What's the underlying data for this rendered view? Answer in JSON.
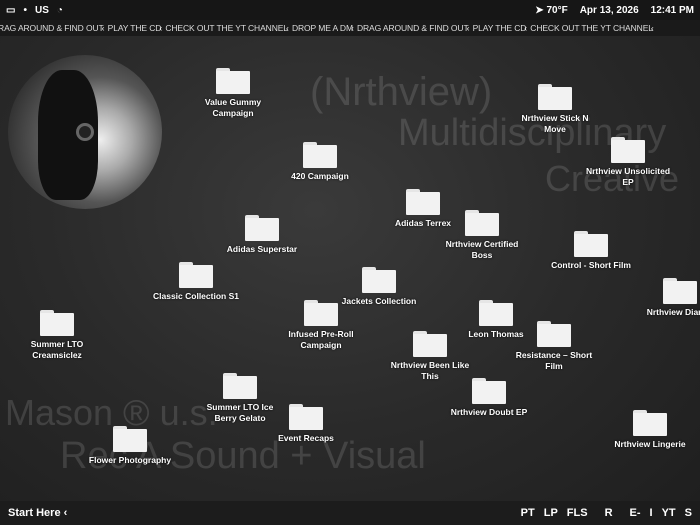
{
  "menubar": {
    "language": "US",
    "weather": "70°F",
    "date": "Apr 13, 2026",
    "time": "12:41 PM"
  },
  "ticker": [
    "DRAG AROUND & FIND OUT",
    "PLAY THE CD",
    "CHECK OUT THE YT CHANNEL",
    "DROP ME A DM",
    "DRAG AROUND & FIND OUT",
    "PLAY THE CD",
    "CHECK OUT THE YT CHANNEL"
  ],
  "background_text": [
    "(Nrthview)",
    "Multidisciplinary",
    "Creative",
    "Mason ® u.s.",
    "Rec A Sound + Visual"
  ],
  "folders": [
    "Value Gummy Campaign",
    "420 Campaign",
    "Nrthview Stick N Move",
    "Nrthview Unsolicited EP",
    "Adidas Terrex",
    "Nrthview Certified Boss",
    "Adidas Superstar",
    "Control - Short Film",
    "Classic Collection S1",
    "Jackets Collection",
    "Nrthview Diaries",
    "Infused Pre-Roll Campaign",
    "Leon Thomas",
    "Summer LTO Creamsiclez",
    "Resistance – Short Film",
    "Nrthview Been Like This",
    "Summer LTO Ice Berry Gelato",
    "Nrthview Doubt EP",
    "Event Recaps",
    "Nrthview Lingerie",
    "Flower Photography"
  ],
  "bottombar": {
    "start": "Start Here",
    "links": [
      "PT",
      "LP",
      "FLS",
      "R",
      "E-",
      "I",
      "YT",
      "S"
    ]
  }
}
